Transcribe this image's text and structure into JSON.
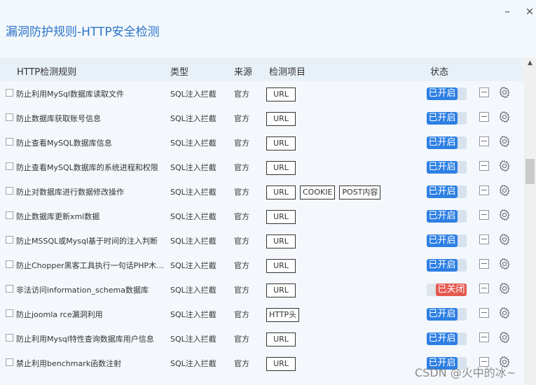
{
  "window": {
    "title": "漏洞防护规则-HTTP安全检测",
    "minimize": "–",
    "close": "×"
  },
  "headers": {
    "rule": "HTTP检测规则",
    "type": "类型",
    "source": "来源",
    "items": "检测项目",
    "status": "状态"
  },
  "rows": [
    {
      "name": "防止利用MySql数据库读取文件",
      "type": "SQL注入拦截",
      "source": "官方",
      "items": [
        "URL"
      ],
      "status": "已开启",
      "on": true
    },
    {
      "name": "防止数据库获取账号信息",
      "type": "SQL注入拦截",
      "source": "官方",
      "items": [
        "URL"
      ],
      "status": "已开启",
      "on": true
    },
    {
      "name": "防止查看MySQL数据库信息",
      "type": "SQL注入拦截",
      "source": "官方",
      "items": [
        "URL"
      ],
      "status": "已开启",
      "on": true
    },
    {
      "name": "防止查看MySQL数据库的系统进程和权限",
      "type": "SQL注入拦截",
      "source": "官方",
      "items": [
        "URL"
      ],
      "status": "已开启",
      "on": true
    },
    {
      "name": "防止对数据库进行数据修改操作",
      "type": "SQL注入拦截",
      "source": "官方",
      "items": [
        "URL",
        "COOKIE",
        "POST内容"
      ],
      "status": "已开启",
      "on": true
    },
    {
      "name": "防止数据库更新xml数据",
      "type": "SQL注入拦截",
      "source": "官方",
      "items": [
        "URL"
      ],
      "status": "已开启",
      "on": true
    },
    {
      "name": "防止MSSQL或Mysql基于时间的注入判断",
      "type": "SQL注入拦截",
      "source": "官方",
      "items": [
        "URL"
      ],
      "status": "已开启",
      "on": true
    },
    {
      "name": "防止Chopper黑客工具执行一句话PHP木...",
      "type": "SQL注入拦截",
      "source": "官方",
      "items": [
        "URL"
      ],
      "status": "已开启",
      "on": true
    },
    {
      "name": "非法访问information_schema数据库",
      "type": "SQL注入拦截",
      "source": "官方",
      "items": [
        "URL"
      ],
      "status": "已关闭",
      "on": false
    },
    {
      "name": "防止joomla rce漏洞利用",
      "type": "SQL注入拦截",
      "source": "官方",
      "items": [
        "HTTP头"
      ],
      "status": "已开启",
      "on": true
    },
    {
      "name": "防止利用Mysql特性查询数据库用户信息",
      "type": "SQL注入拦截",
      "source": "官方",
      "items": [
        "URL"
      ],
      "status": "已开启",
      "on": true
    },
    {
      "name": "禁止利用benchmark函数注射",
      "type": "SQL注入拦截",
      "source": "官方",
      "items": [
        "URL"
      ],
      "status": "已开启",
      "on": true
    }
  ],
  "watermark": "CSDN @火中的冰~"
}
